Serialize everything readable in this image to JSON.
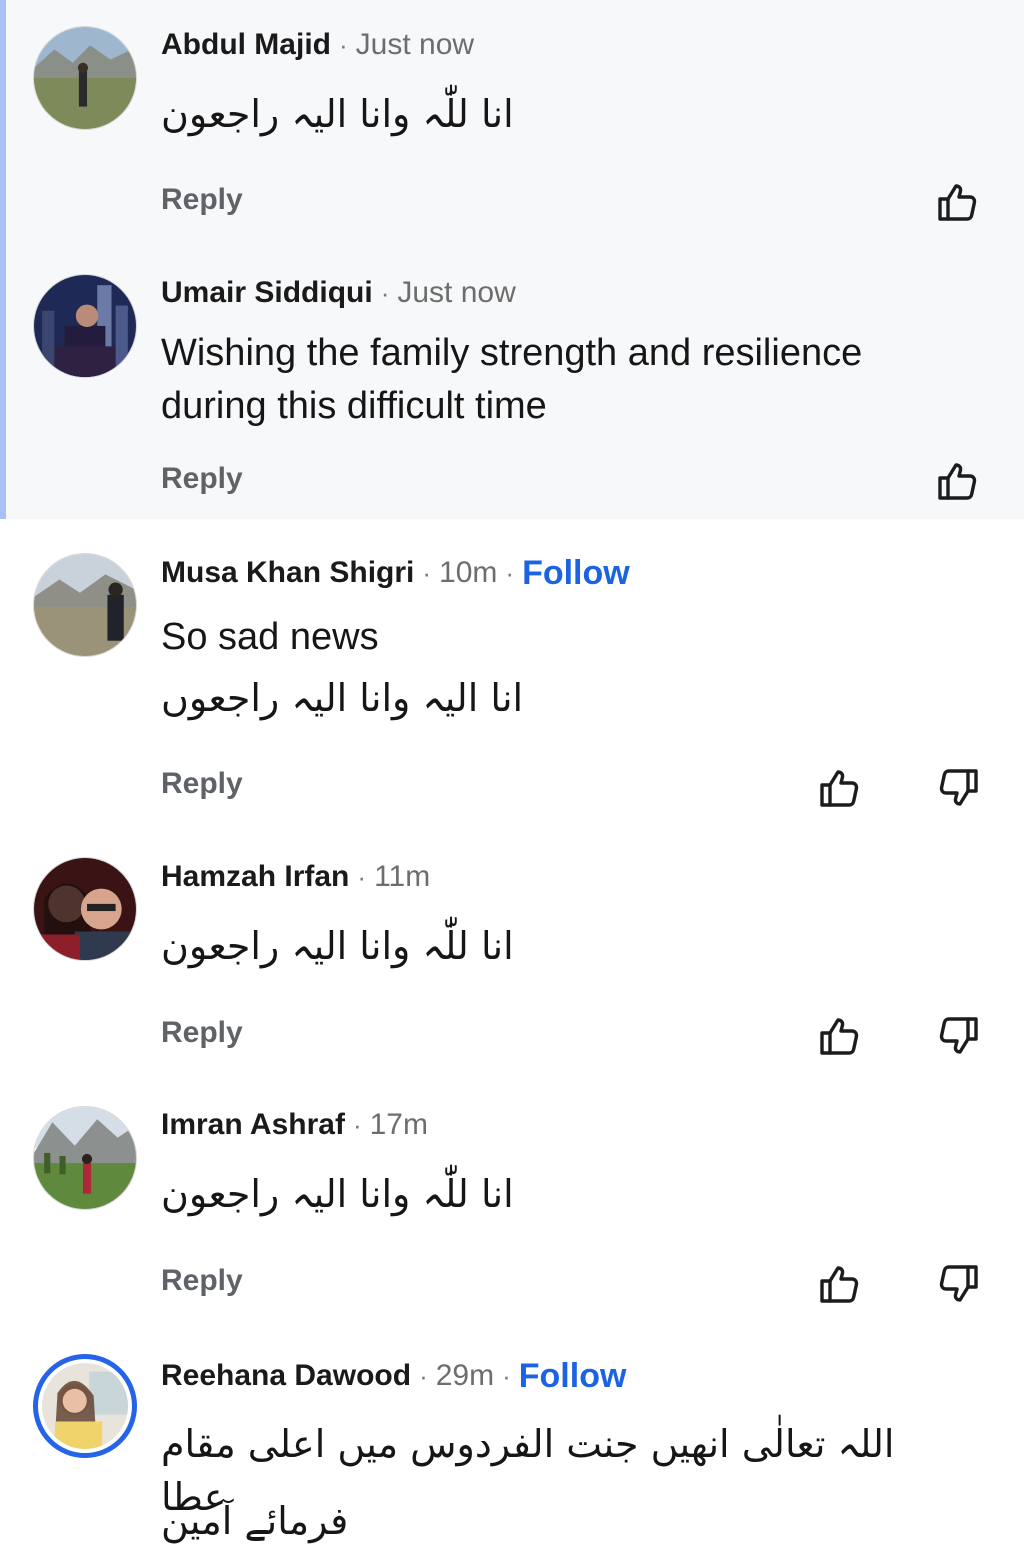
{
  "comments": [
    {
      "name": "Abdul Majid",
      "sep": "·",
      "time": "Just now",
      "text": "انا للّٰہ وانا الیہ راجعون",
      "reply": "Reply"
    },
    {
      "name": "Umair Siddiqui",
      "sep": "·",
      "time": "Just now",
      "text": "Wishing the family strength and resilience during this difficult time",
      "reply": "Reply"
    },
    {
      "name": "Musa Khan Shigri",
      "sep": "·",
      "time": "10m",
      "sep2": "·",
      "follow": "Follow",
      "text": "So sad news",
      "text2": "انا الیہ وانا الیہ راجعوں",
      "reply": "Reply"
    },
    {
      "name": "Hamzah Irfan",
      "sep": "·",
      "time": "11m",
      "text": "انا للّٰہ وانا الیہ راجعون",
      "reply": "Reply"
    },
    {
      "name": "Imran Ashraf",
      "sep": "·",
      "time": "17m",
      "text": "انا للّٰہ وانا الیہ راجعون",
      "reply": "Reply"
    },
    {
      "name": "Reehana Dawood",
      "sep": "·",
      "time": "29m",
      "sep2": "·",
      "follow": "Follow",
      "text": "اللہ تعالٰی انھیں جنت الفردوس میں اعلی مقام عطا",
      "text2": "فرمائے آمین"
    }
  ],
  "icons": {
    "like": "thumbs-up-icon",
    "dislike": "thumbs-down-icon"
  },
  "colors": {
    "follow": "#1b63e3",
    "highlight_bg": "#f7f8fa",
    "highlight_bar": "#a9bff5",
    "story_ring": "#2563e8"
  }
}
